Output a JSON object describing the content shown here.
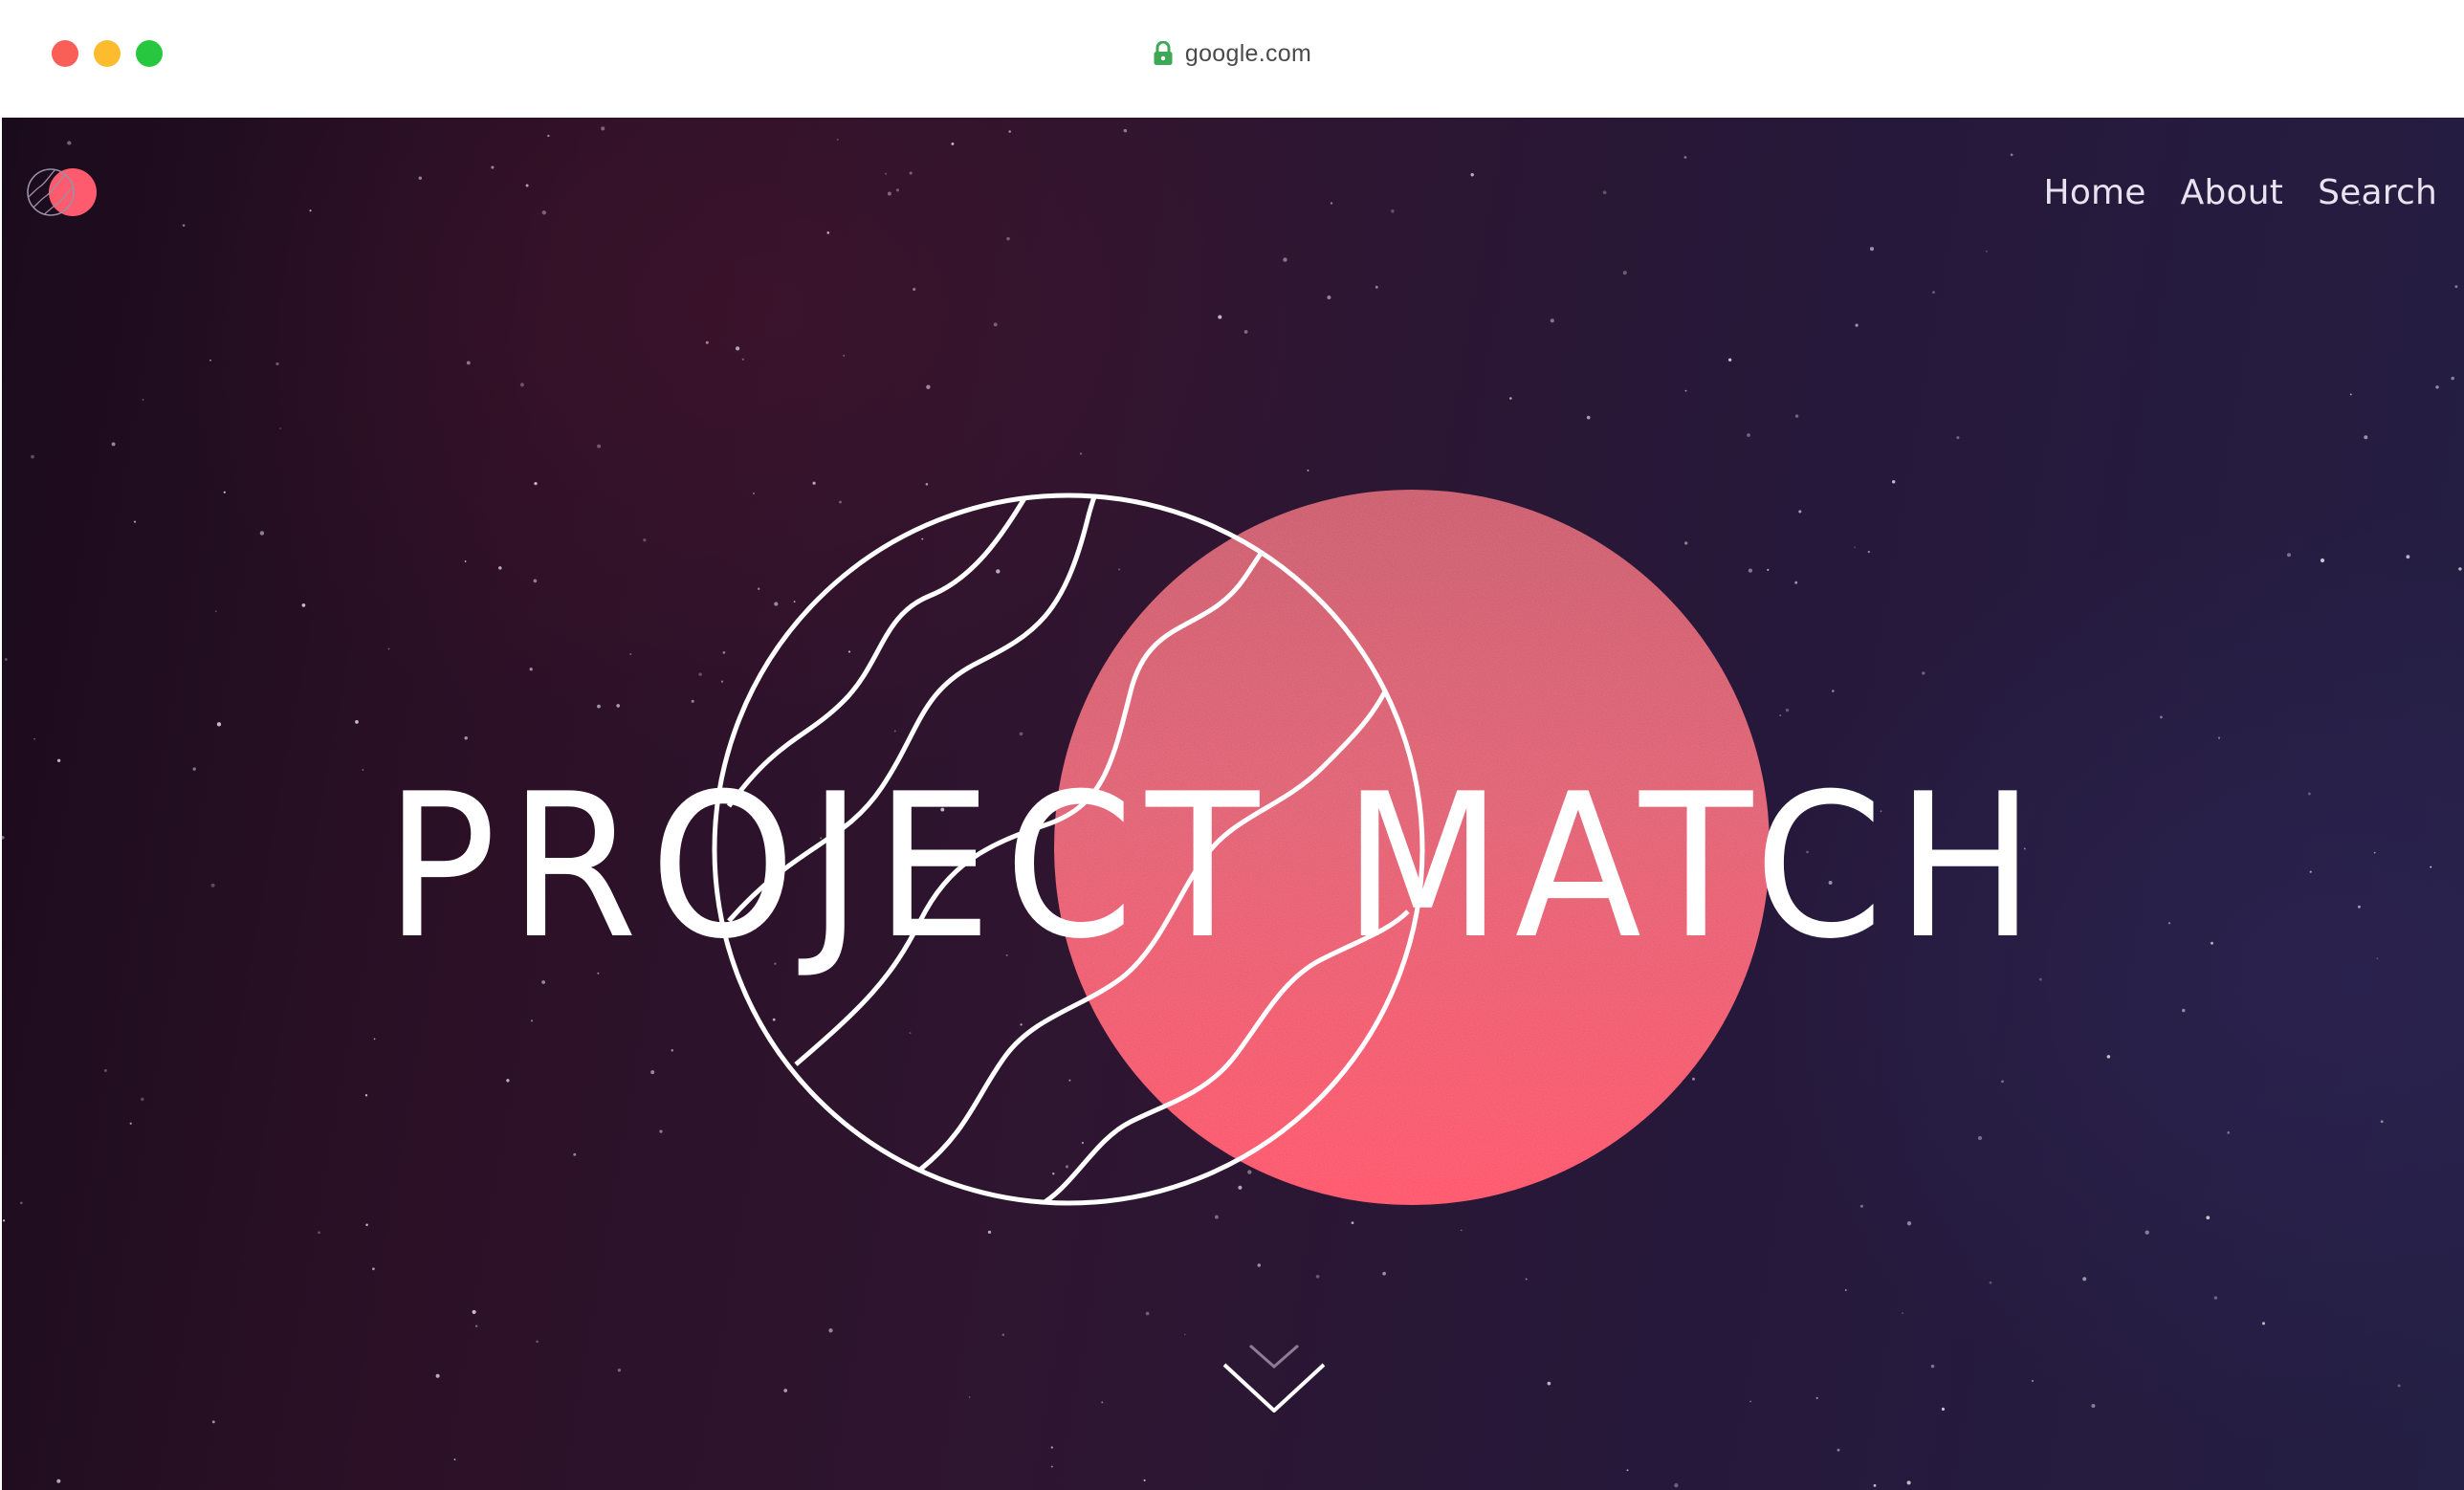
{
  "browser": {
    "window_controls": [
      "close",
      "minimize",
      "zoom"
    ],
    "address_bar": {
      "url": "google.com",
      "secure_icon": "lock-icon",
      "lock_color": "#3fa857"
    }
  },
  "site": {
    "logo_icon": "project-match-logo-icon",
    "nav": {
      "home": "Home",
      "about": "About",
      "search": "Search"
    },
    "hero": {
      "title": "PROJECT MATCH",
      "line_art_icon": "wavy-line-circle-icon",
      "sphere_icon": "coral-sphere-icon",
      "scroll_icon": "chevron-down-icon"
    }
  },
  "colors": {
    "accent_coral": "#ff5468",
    "coral_light": "#d55b6a",
    "background_dark": "#1f0e1f",
    "background_violet": "#261f44",
    "text_light": "#ffffff"
  }
}
